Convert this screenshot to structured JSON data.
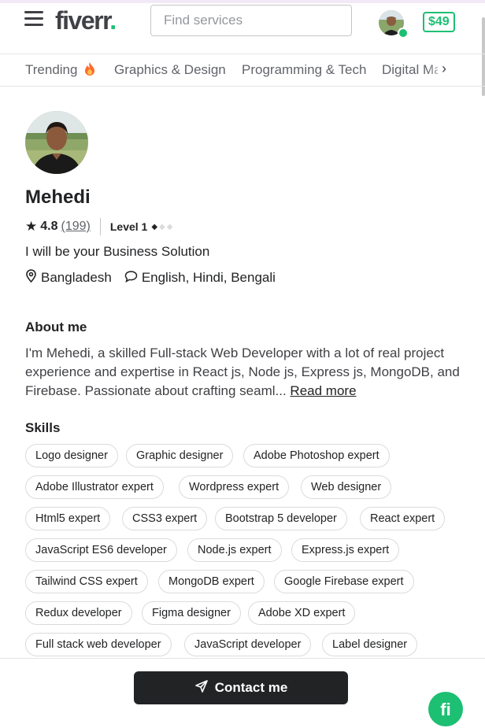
{
  "header": {
    "logo_text": "fiverr",
    "logo_dot": ".",
    "search_placeholder": "Find services",
    "balance": "$49"
  },
  "categories": [
    {
      "label": "Trending"
    },
    {
      "label": "Graphics & Design"
    },
    {
      "label": "Programming & Tech"
    },
    {
      "label": "Digital Ma"
    }
  ],
  "profile": {
    "name": "Mehedi",
    "rating": "4.8",
    "reviews": "(199)",
    "level": "Level 1",
    "tagline": "I will be your Business Solution",
    "location": "Bangladesh",
    "languages": "English, Hindi, Bengali"
  },
  "about": {
    "title": "About me",
    "text": "I'm Mehedi, a skilled Full-stack Web Developer with a lot of real project experience and expertise in React js, Node js, Express js, MongoDB, and Firebase. Passionate about crafting seaml...",
    "read_more": "Read more"
  },
  "skills": {
    "title": "Skills",
    "items": [
      "Logo designer",
      "Graphic designer",
      "Adobe Photoshop expert",
      "Adobe Illustrator expert",
      "Wordpress expert",
      "Web designer",
      "Html5 expert",
      "CSS3 expert",
      "Bootstrap 5 developer",
      "React expert",
      "JavaScript ES6 developer",
      "Node.js expert",
      "Express.js expert",
      "Tailwind CSS expert",
      "MongoDB expert",
      "Google Firebase expert",
      "Redux developer",
      "Figma designer",
      "Adobe XD expert",
      "Full stack web developer",
      "JavaScript developer",
      "Label designer"
    ]
  },
  "footer": {
    "contact_label": "Contact me",
    "badge_text": "fi"
  },
  "colors": {
    "brand_green": "#1dbf73",
    "text_dark": "#222325",
    "button_dark": "#222325"
  },
  "icons": [
    "menu-icon",
    "fire-icon",
    "chevron-right-icon",
    "star-icon",
    "diamond-icon",
    "location-pin-icon",
    "chat-bubble-icon",
    "send-icon"
  ]
}
